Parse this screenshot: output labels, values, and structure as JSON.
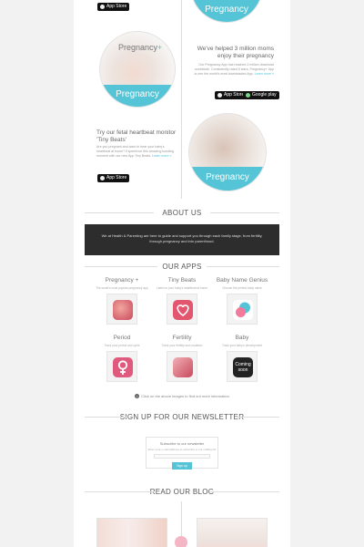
{
  "timeline": {
    "brand_text": "Pregnancy",
    "brand_plus": "+",
    "band_text": "Pregnancy",
    "items": [
      {
        "heading": "We've helped 3 million moms enjoy their pregnancy",
        "body": "Our Pregnancy App has reached 3 million download worldwide. Consistently rated 5 stars, Pregnancy+ App is one the world's most downloaded App.",
        "more": "Learn more »"
      },
      {
        "heading": "Try our fetal heartbeat monitor 'Tiny Beats'",
        "body": "Are you pregnant and want to hear your baby's heartbeat at home? Experience this amazing bonding moment with our new App Tiny Beats.",
        "more": "Learn more »"
      }
    ],
    "app_store_label": "App Store",
    "google_play_label": "Google play"
  },
  "about": {
    "title": "ABOUT US",
    "text": "We at Health & Parenting are here to guide and support you through each family stage, from fertility, through pregnancy and into parenthood."
  },
  "apps": {
    "title": "OUR APPS",
    "items": [
      {
        "name": "Pregnancy +",
        "desc": "The world's most popular pregnancy app",
        "icon": "pregnancy-app-icon",
        "color": "#c9495c"
      },
      {
        "name": "Tiny Beats",
        "desc": "Listen to your baby's heartbeat at home",
        "icon": "tiny-beats-app-icon",
        "color": "#e2566f"
      },
      {
        "name": "Baby Name Genius",
        "desc": "Choose the perfect baby name",
        "icon": "baby-name-genius-app-icon",
        "color": "#55c4d6"
      },
      {
        "name": "Period",
        "desc": "Track your period and cycle",
        "icon": "period-app-icon",
        "color": "#e05a7e"
      },
      {
        "name": "Fertility",
        "desc": "Track your fertility and ovulation",
        "icon": "fertility-app-icon",
        "color": "#c94a5e"
      },
      {
        "name": "Baby",
        "desc": "Track your baby's development",
        "icon": "baby-app-icon",
        "color": "#222222"
      }
    ],
    "coming_soon": "Coming soon",
    "note": "Click on the above images to find out more information"
  },
  "newsletter": {
    "title": "SIGN UP FOR OUR NEWSLETTER",
    "box_title": "Subscribe to our newsletter",
    "box_sub": "Enter your e-mail address to subscribe to our mailing list",
    "button": "Sign up"
  },
  "blog": {
    "title": "READ OUR BLOG"
  },
  "colors": {
    "accent": "#55c4d6",
    "dark_box": "#2d2d2d"
  }
}
